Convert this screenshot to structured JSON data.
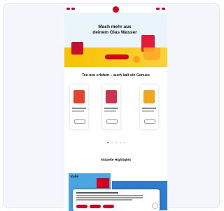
{
  "hero": {
    "headline": "Mach mehr aus deinem Glas Wasser",
    "cta": ""
  },
  "sections": {
    "discover_title": "Tee neu erleben – auch kalt ein Genuss",
    "highlights_title": "Aktuelle Highlights"
  },
  "highlight": {
    "label": "Kalte"
  },
  "products": [
    {
      "name": "",
      "color": "#e8412c"
    },
    {
      "name": "",
      "color": "#d0324f"
    },
    {
      "name": "",
      "color": "#f3a51c"
    }
  ],
  "colors": {
    "brand": "#d6001c",
    "hero_bg": "#e9f5fb",
    "card_bg": "#f4f6fb"
  },
  "icons": [
    "menu-icon",
    "search-icon",
    "logo-icon",
    "cart-icon",
    "chat-icon"
  ]
}
